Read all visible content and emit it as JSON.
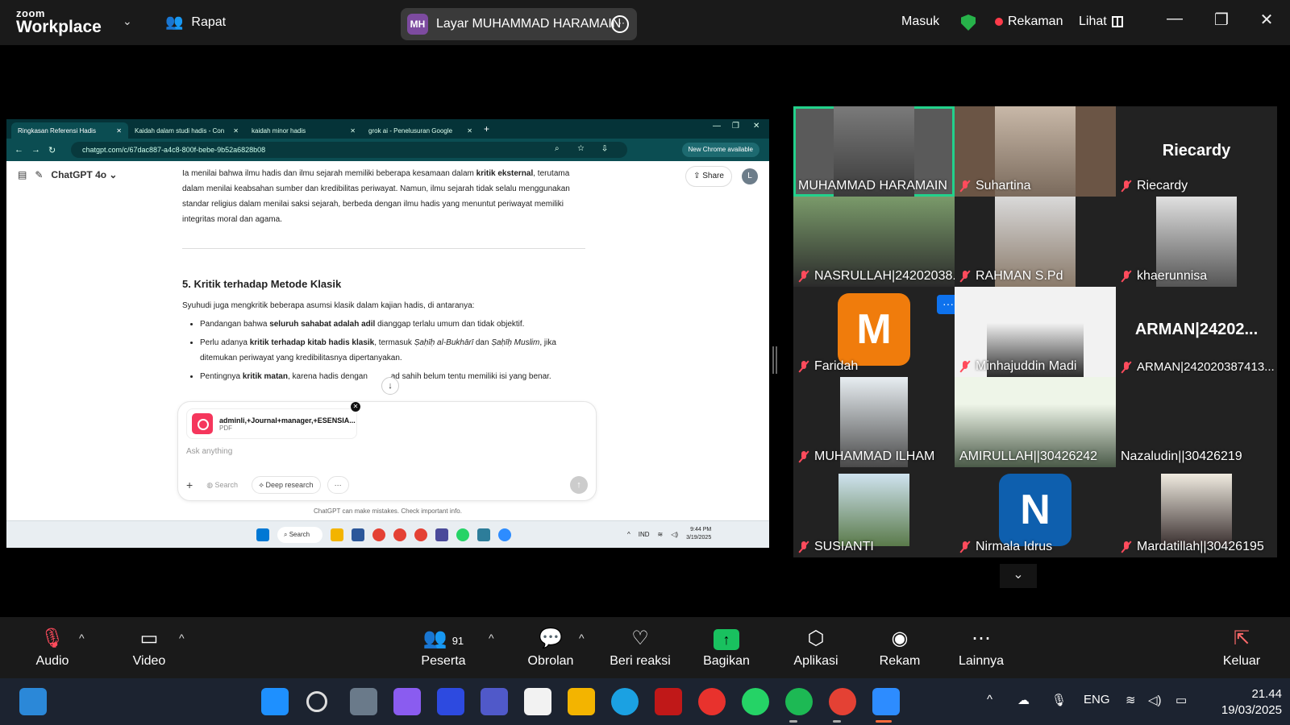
{
  "zoom": {
    "logo_top": "zoom",
    "logo_bottom": "Workplace",
    "meeting_label": "Rapat",
    "share_badge": "MH",
    "share_label": "Layar MUHAMMAD HARAMAIN",
    "signin": "Masuk",
    "recording": "Rekaman",
    "view": "Lihat"
  },
  "browser": {
    "tabs": [
      "Ringkasan Referensi Hadis",
      "Kaidah dalam studi hadis - Con",
      "kaidah minor hadis",
      "grok ai - Penelusuran Google"
    ],
    "url": "chatgpt.com/c/67dac887-a4c8-800f-bebe-9b52a6828b08",
    "new_chrome": "New Chrome available"
  },
  "chatgpt": {
    "model": "ChatGPT 4o",
    "share": "Share",
    "user_initial": "L",
    "para1_a": "Ia menilai bahwa ilmu hadis dan ilmu sejarah memiliki beberapa kesamaan dalam ",
    "para1_b": "kritik eksternal",
    "para1_c": ", terutama dalam menilai keabsahan sumber dan kredibilitas periwayat. Namun, ilmu sejarah tidak selalu menggunakan standar religius dalam menilai saksi sejarah, berbeda dengan ilmu hadis yang menuntut periwayat memiliki integritas moral dan agama.",
    "heading": "5. Kritik terhadap Metode Klasik",
    "intro": "Syuhudi juga mengkritik beberapa asumsi klasik dalam kajian hadis, di antaranya:",
    "b1_a": "Pandangan bahwa ",
    "b1_b": "seluruh sahabat adalah adil",
    "b1_c": " dianggap terlalu umum dan tidak objektif.",
    "b2_a": "Perlu adanya ",
    "b2_b": "kritik terhadap kitab hadis klasik",
    "b2_c": ", termasuk ",
    "b2_d": "Ṣaḥīḥ al-Bukhārī",
    "b2_e": " dan ",
    "b2_f": "Ṣaḥīḥ Muslim",
    "b2_g": ", jika ditemukan periwayat yang kredibilitasnya dipertanyakan.",
    "b3_a": "Pentingnya ",
    "b3_b": "kritik matan",
    "b3_c": ", karena hadis dengan ",
    "b3_d": "ad sahih belum tentu memiliki isi yang benar.",
    "attachment_name": "adminli,+Journal+manager,+ESENSIA...",
    "attachment_type": "PDF",
    "placeholder": "Ask anything",
    "search": "Search",
    "deep_research": "Deep research",
    "disclaimer": "ChatGPT can make mistakes. Check important info."
  },
  "inner_taskbar": {
    "search": "Search",
    "lang": "IND",
    "time": "9:44 PM",
    "date": "3/19/2025"
  },
  "participants": [
    {
      "name": "MUHAMMAD HARAMAIN",
      "muted": false
    },
    {
      "name": "Suhartina",
      "muted": true
    },
    {
      "name": "Riecardy",
      "muted": true,
      "display": "Riecardy"
    },
    {
      "name": "NASRULLAH|24202038...",
      "muted": true
    },
    {
      "name": "RAHMAN S.Pd",
      "muted": true
    },
    {
      "name": "khaerunnisa",
      "muted": true
    },
    {
      "name": "Faridah",
      "muted": true,
      "initial": "M"
    },
    {
      "name": "Minhajuddin Madi",
      "muted": true
    },
    {
      "name": "ARMAN|242020387413...",
      "muted": true,
      "display": "ARMAN|24202..."
    },
    {
      "name": "MUHAMMAD ILHAM",
      "muted": true
    },
    {
      "name": "AMIRULLAH||30426242",
      "muted": false
    },
    {
      "name": "Nazaludin||30426219",
      "muted": false
    },
    {
      "name": "SUSIANTI",
      "muted": true
    },
    {
      "name": "Nirmala Idrus",
      "muted": true,
      "initial": "N"
    },
    {
      "name": "Mardatillah||30426195",
      "muted": true
    }
  ],
  "toolbar": {
    "audio": "Audio",
    "video": "Video",
    "participants": "Peserta",
    "participants_count": "91",
    "chat": "Obrolan",
    "react": "Beri reaksi",
    "share": "Bagikan",
    "apps": "Aplikasi",
    "record": "Rekam",
    "more": "Lainnya",
    "leave": "Keluar"
  },
  "system_taskbar": {
    "lang": "ENG",
    "time": "21.44",
    "date": "19/03/2025"
  },
  "colors": {
    "active_speaker": "#23d18b",
    "muted_red": "#ff4b5c",
    "share_green": "#19c15f",
    "faridah_avatar": "#f07c0c",
    "nirmala_avatar": "#0e5fae"
  }
}
